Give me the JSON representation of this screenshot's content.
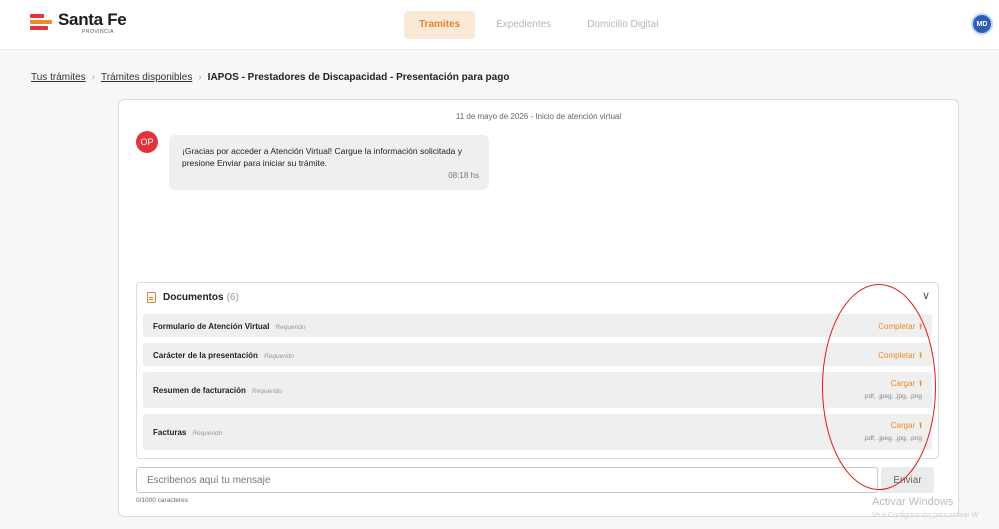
{
  "header": {
    "logo_title": "Santa Fe",
    "logo_subtitle": "PROVINCIA",
    "nav": [
      {
        "label": "Tramites",
        "active": true
      },
      {
        "label": "Expedientes",
        "active": false
      },
      {
        "label": "Domicilio Digital",
        "active": false
      }
    ],
    "user_initials": "MD"
  },
  "breadcrumb": {
    "item1": "Tus trámites",
    "item2": "Trámites disponibles",
    "current": "IAPOS - Prestadores de Discapacidad - Presentación para pago"
  },
  "chat": {
    "date_line": "11 de mayo de 2026 - Inicio de atención virtual",
    "operator_initials": "OP",
    "message": "¡Gracias por acceder a Atención Virtual! Cargue la información solicitada y presione Enviar para iniciar su trámite.",
    "time": "08:18 hs"
  },
  "documents": {
    "title": "Documentos",
    "count": "(6)",
    "items": [
      {
        "name": "Formulario de Atención Virtual",
        "status": "Requerido",
        "action": "Completar",
        "formats": ""
      },
      {
        "name": "Carácter de la presentación",
        "status": "Requerido",
        "action": "Completar",
        "formats": ""
      },
      {
        "name": "Resumen de facturación",
        "status": "Requerido",
        "action": "Cargar",
        "formats": ".pdf, .jpeg, .jpg, .png"
      },
      {
        "name": "Facturas",
        "status": "Requerido",
        "action": "Cargar",
        "formats": ".pdf, .jpeg, .jpg, .png"
      }
    ]
  },
  "composer": {
    "placeholder": "Escribenos aquí tu mensaje",
    "send_label": "Enviar",
    "char_count": "0/1000 caracteres"
  },
  "windows_watermark": {
    "title": "Activar Windows",
    "subtitle": "Ve a Configuración para activar W"
  },
  "colors": {
    "accent": "#f08a24",
    "brand_red": "#e4323a",
    "annotation": "#e21a1a"
  }
}
